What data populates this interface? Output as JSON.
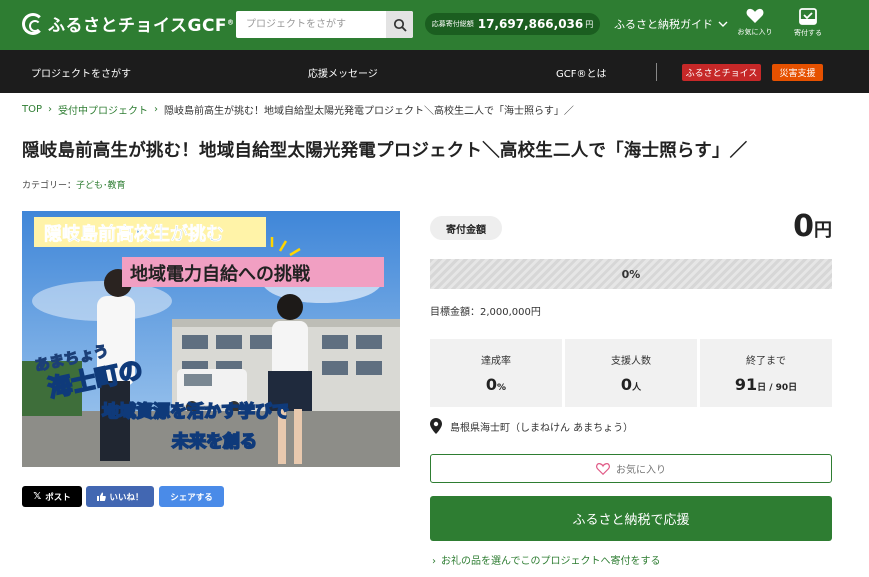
{
  "header": {
    "logo_text": "ふるさとチョイスGCF",
    "logo_reg": "®",
    "search_placeholder": "プロジェクトをさがす",
    "total_label": "応募寄付総額",
    "total_amount": "17,697,866,036",
    "total_unit": "円",
    "guide_label": "ふるさと納税ガイド",
    "favorites_label": "お気に入り",
    "donation_label": "寄付する"
  },
  "nav": {
    "find_projects": "プロジェクトをさがす",
    "messages": "応援メッセージ",
    "about": "GCF®とは",
    "choice_btn": "ふるさとチョイス",
    "disaster_btn": "災害支援"
  },
  "breadcrumb": {
    "top": "TOP",
    "accepting": "受付中プロジェクト",
    "current": "隠岐島前高生が挑む！地域自給型太陽光発電プロジェクト＼高校生二人で「海士照らす」／"
  },
  "project": {
    "title": "隠岐島前高生が挑む！地域自給型太陽光発電プロジェクト＼高校生二人で「海士照らす」／",
    "category_label": "カテゴリー：",
    "category_value": "子ども･教育"
  },
  "hero": {
    "line1": "隠岐島前高校生が挑む",
    "line2": "地域電力自給への挑戦",
    "reading": "あまちょう",
    "town": "海士町の",
    "line3": "地域資源を活かす学びで",
    "line4": "未来を創る"
  },
  "share": {
    "x_post": "ポスト",
    "like": "いいね！",
    "share": "シェアする"
  },
  "funding": {
    "pill": "寄付金額",
    "amount": "0",
    "amount_unit": "円",
    "progress_text": "0%",
    "progress_fraction": 0,
    "goal_label": "目標金額：",
    "goal_value": "2,000,000円"
  },
  "stats": {
    "rate_label": "達成率",
    "rate_value": "0",
    "rate_unit": "%",
    "supporters_label": "支援人数",
    "supporters_value": "0",
    "supporters_unit": "人",
    "deadline_label": "終了まで",
    "deadline_value": "91",
    "deadline_unit": "日 / 90日"
  },
  "location": {
    "text": "島根県海士町（しまねけん あまちょう）"
  },
  "actions": {
    "favorite": "お気に入り",
    "donate": "ふるさと納税で応援",
    "gift_link": "お礼の品を選んでこのプロジェクトへ寄付をする"
  },
  "colors": {
    "brand_green": "#2e7d32",
    "dark_nav": "#1c1c1c",
    "choice_red": "#c62828",
    "disaster_orange": "#e65100"
  }
}
